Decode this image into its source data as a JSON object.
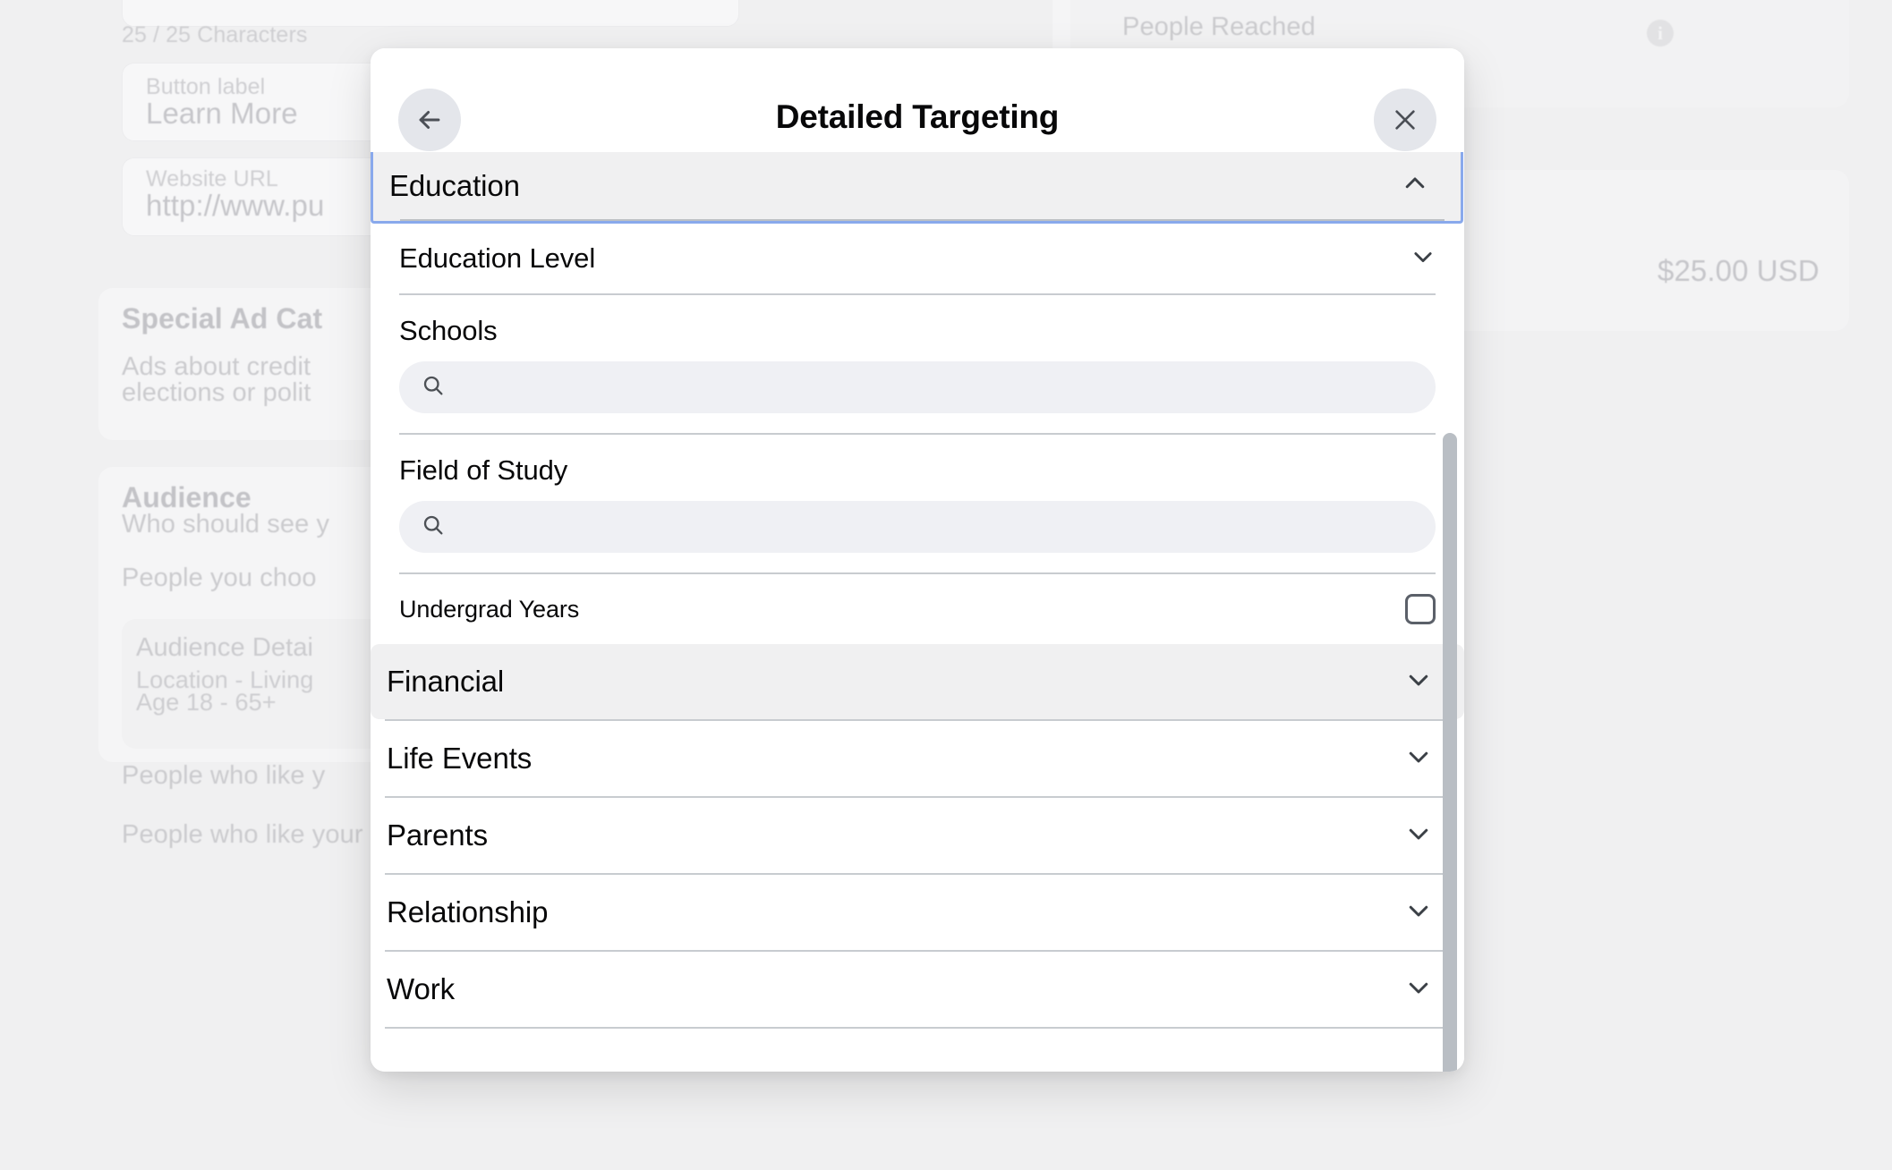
{
  "background": {
    "char_counter": "25 / 25 Characters",
    "button_label_field": {
      "label": "Button label",
      "value": "Learn More"
    },
    "website_url_field": {
      "label": "Website URL",
      "value": "http://www.pu"
    },
    "special_ad_card": {
      "title": "Special Ad Cat",
      "body_line1": "Ads about credit",
      "body_line2": "elections or polit"
    },
    "audience_card": {
      "title": "Audience",
      "subtitle": "Who should see y",
      "option": "People you choo",
      "detail_title": "Audience Detai",
      "detail_line1": "Location - Living",
      "detail_line2": "Age 18 - 65+"
    },
    "audience_options": {
      "option_partial": "People who like y",
      "option_full": "People who like your Page and their friends"
    },
    "right_panel": {
      "people_reached": "People Reached",
      "info_icon": "info-icon",
      "budget": "$25.00 USD"
    }
  },
  "modal": {
    "title": "Detailed Targeting",
    "back_icon": "arrow-left-icon",
    "close_icon": "close-icon",
    "focused_section": {
      "label": "Education",
      "chevron": "chevron-up-icon",
      "expanded": true
    },
    "education_panel": {
      "education_level": {
        "label": "Education Level",
        "chevron": "chevron-down-icon"
      },
      "schools": {
        "label": "Schools",
        "search_icon": "search-icon",
        "value": "",
        "placeholder": ""
      },
      "field_of_study": {
        "label": "Field of Study",
        "search_icon": "search-icon",
        "value": "",
        "placeholder": ""
      },
      "undergrad_years": {
        "label": "Undergrad Years",
        "checkbox": "checkbox-unchecked",
        "checked": false
      }
    },
    "sections": [
      {
        "label": "Financial",
        "chevron": "chevron-down-icon",
        "hovered": true
      },
      {
        "label": "Life Events",
        "chevron": "chevron-down-icon",
        "hovered": false
      },
      {
        "label": "Parents",
        "chevron": "chevron-down-icon",
        "hovered": false
      },
      {
        "label": "Relationship",
        "chevron": "chevron-down-icon",
        "hovered": false
      },
      {
        "label": "Work",
        "chevron": "chevron-down-icon",
        "hovered": false
      }
    ],
    "scrollbar": "vertical-scrollbar"
  },
  "colors": {
    "focus_ring": "#89a9ec",
    "row_hover": "#f0f0f1",
    "search_field": "#eff0f4",
    "header_button": "#e4e6eb",
    "scrollbar_thumb": "#b9bec4",
    "text_primary": "#080809"
  }
}
